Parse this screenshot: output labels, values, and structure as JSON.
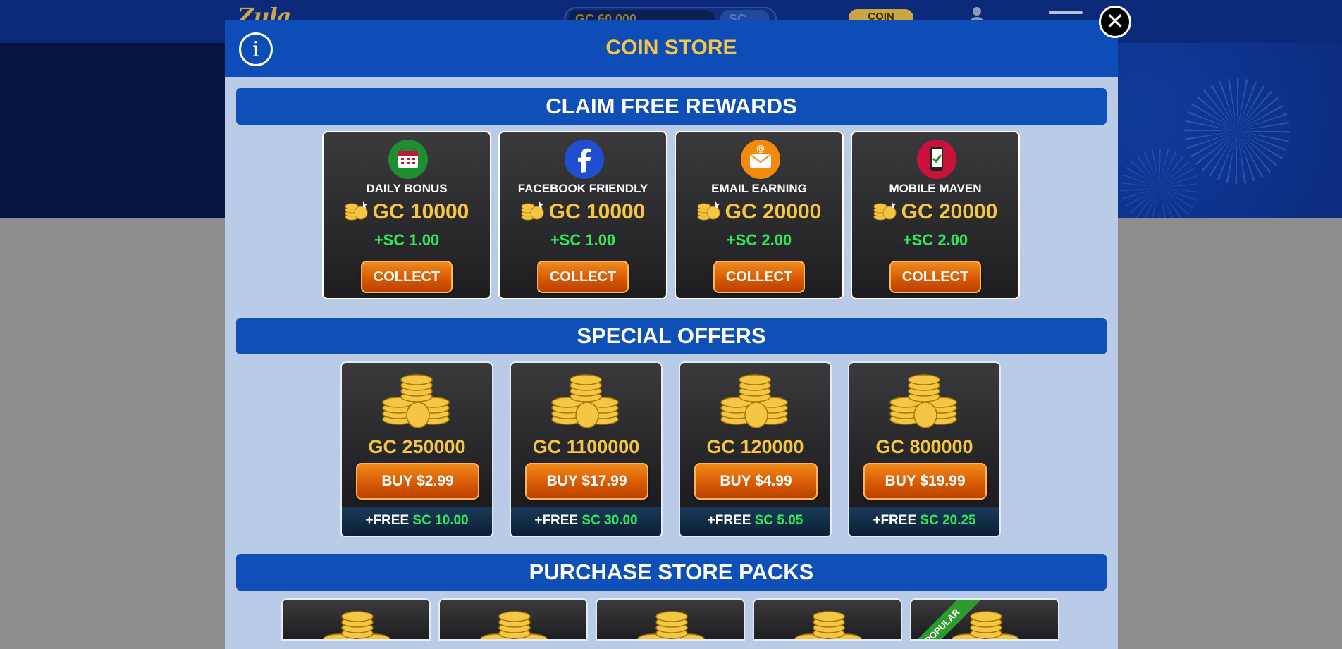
{
  "background": {
    "logo": "Zula",
    "balance": "GC 60,000",
    "sc_balance": "SC",
    "coin_button": "COIN"
  },
  "modal": {
    "title": "COIN STORE",
    "info_label": "i",
    "close_label": "✕"
  },
  "sections": {
    "rewards": "CLAIM FREE REWARDS",
    "offers": "SPECIAL OFFERS",
    "packs": "PURCHASE STORE PACKS"
  },
  "rewards": [
    {
      "name": "DAILY BONUS",
      "gc": "GC 10000",
      "sc": "+SC 1.00",
      "button": "COLLECT",
      "icon": "calendar-icon",
      "color": "#1e8f2e"
    },
    {
      "name": "FACEBOOK FRIENDLY",
      "gc": "GC 10000",
      "sc": "+SC 1.00",
      "button": "COLLECT",
      "icon": "facebook-icon",
      "color": "#1f4fd0"
    },
    {
      "name": "EMAIL EARNING",
      "gc": "GC 20000",
      "sc": "+SC 2.00",
      "button": "COLLECT",
      "icon": "email-icon",
      "color": "#f28a0e"
    },
    {
      "name": "MOBILE MAVEN",
      "gc": "GC 20000",
      "sc": "+SC 2.00",
      "button": "COLLECT",
      "icon": "mobile-icon",
      "color": "#c8123a"
    }
  ],
  "offers": [
    {
      "gc": "GC 250000",
      "button": "BUY $2.99",
      "free_prefix": "+FREE",
      "free_sc": "SC 10.00"
    },
    {
      "gc": "GC 1100000",
      "button": "BUY $17.99",
      "free_prefix": "+FREE",
      "free_sc": "SC 30.00"
    },
    {
      "gc": "GC 120000",
      "button": "BUY $4.99",
      "free_prefix": "+FREE",
      "free_sc": "SC 5.05"
    },
    {
      "gc": "GC 800000",
      "button": "BUY $19.99",
      "free_prefix": "+FREE",
      "free_sc": "SC 20.25"
    }
  ],
  "packs": [
    {
      "ribbon": ""
    },
    {
      "ribbon": ""
    },
    {
      "ribbon": ""
    },
    {
      "ribbon": ""
    },
    {
      "ribbon": "POPULAR"
    }
  ],
  "colors": {
    "accent_gold": "#f5c644",
    "sc_green": "#2ee95c",
    "header_blue": "#0e4db8",
    "button_orange": "#d85a05"
  }
}
